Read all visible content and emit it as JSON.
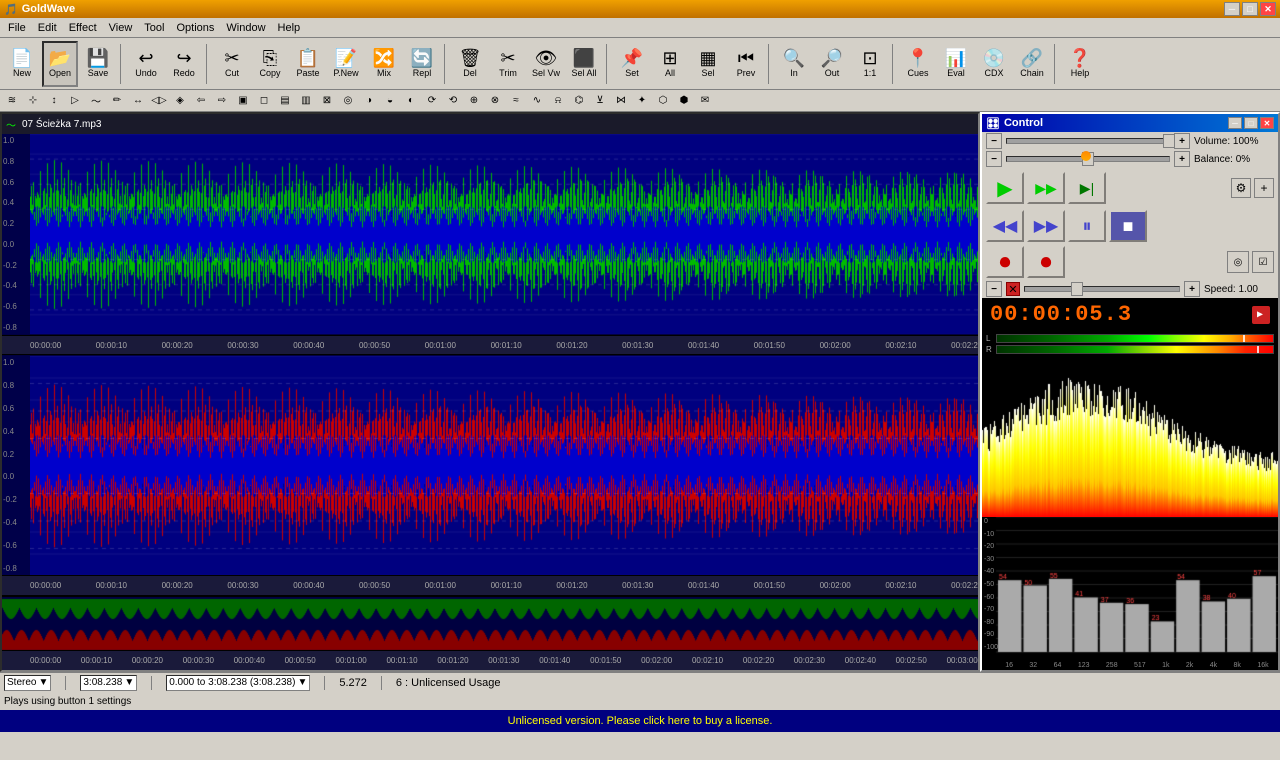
{
  "app": {
    "title": "GoldWave",
    "icon": "🎵"
  },
  "titlebar": {
    "minimize": "─",
    "maximize": "□",
    "close": "✕"
  },
  "menu": {
    "items": [
      "File",
      "Edit",
      "Effect",
      "View",
      "Tool",
      "Options",
      "Window",
      "Help"
    ]
  },
  "toolbar": {
    "buttons": [
      {
        "id": "new",
        "icon": "📄",
        "label": "New"
      },
      {
        "id": "open",
        "icon": "📂",
        "label": "Open"
      },
      {
        "id": "save",
        "icon": "💾",
        "label": "Save"
      },
      {
        "id": "undo",
        "icon": "↩",
        "label": "Undo"
      },
      {
        "id": "redo",
        "icon": "↪",
        "label": "Redo"
      },
      {
        "id": "cut",
        "icon": "✂",
        "label": "Cut"
      },
      {
        "id": "copy",
        "icon": "⎘",
        "label": "Copy"
      },
      {
        "id": "paste",
        "icon": "📋",
        "label": "Paste"
      },
      {
        "id": "pnew",
        "icon": "📝",
        "label": "P.New"
      },
      {
        "id": "mix",
        "icon": "🔀",
        "label": "Mix"
      },
      {
        "id": "repl",
        "icon": "🔄",
        "label": "Repl"
      },
      {
        "id": "del",
        "icon": "🗑",
        "label": "Del"
      },
      {
        "id": "trim",
        "icon": "✂",
        "label": "Trim"
      },
      {
        "id": "selvw",
        "icon": "👁",
        "label": "Sel Vw"
      },
      {
        "id": "selall",
        "icon": "⬛",
        "label": "Sel All"
      },
      {
        "id": "set",
        "icon": "📌",
        "label": "Set"
      },
      {
        "id": "all",
        "icon": "⊞",
        "label": "All"
      },
      {
        "id": "sel",
        "icon": "▦",
        "label": "Sel"
      },
      {
        "id": "prev",
        "icon": "⏮",
        "label": "Prev"
      },
      {
        "id": "zin",
        "icon": "🔍",
        "label": "In"
      },
      {
        "id": "zout",
        "icon": "🔍",
        "label": "Out"
      },
      {
        "id": "z11",
        "icon": "⊡",
        "label": "1:1"
      },
      {
        "id": "cues",
        "icon": "📍",
        "label": "Cues"
      },
      {
        "id": "eval",
        "icon": "📊",
        "label": "Eval"
      },
      {
        "id": "cdx",
        "icon": "💿",
        "label": "CDX"
      },
      {
        "id": "chain",
        "icon": "🔗",
        "label": "Chain"
      },
      {
        "id": "help",
        "icon": "❓",
        "label": "Help"
      }
    ]
  },
  "track": {
    "filename": "07 Ścieżka 7.mp3",
    "duration": "3:08.238",
    "selection": "0.000 to 3:08.238 (3:08.238)",
    "zoom": "5.272",
    "license": "6 : Unlicensed Usage"
  },
  "timeline_marks": [
    "00:00:00",
    "00:00:10",
    "00:00:20",
    "00:00:30",
    "00:00:40",
    "00:00:50",
    "00:01:00",
    "00:01:10",
    "00:01:20",
    "00:01:30",
    "00:01:40",
    "00:01:50",
    "00:02:00",
    "00:02:10",
    "00:02:2"
  ],
  "overview_marks": [
    "00:00:00",
    "00:00:10",
    "00:00:20",
    "00:00:30",
    "00:00:40",
    "00:00:50",
    "00:01:00",
    "00:01:10",
    "00:01:20",
    "00:01:30",
    "00:01:40",
    "00:01:50",
    "00:02:00",
    "00:02:10",
    "00:02:20",
    "00:02:30",
    "00:02:40",
    "00:02:50",
    "00:03:00"
  ],
  "control": {
    "title": "Control",
    "volume_label": "Volume: 100%",
    "balance_label": "Balance: 0%",
    "speed_label": "Speed: 1.00",
    "time": "00:00:05.3",
    "time_icon": "🔴"
  },
  "playback_buttons": [
    {
      "id": "play",
      "icon": "▶",
      "color": "#00cc00"
    },
    {
      "id": "play-loop",
      "icon": "▶▶",
      "color": "#00cc00"
    },
    {
      "id": "play-end",
      "icon": "▶|",
      "color": "#008800"
    },
    {
      "id": "rewind",
      "icon": "◀◀",
      "color": "#4444cc"
    },
    {
      "id": "forward",
      "icon": "▶▶",
      "color": "#4444cc"
    },
    {
      "id": "pause",
      "icon": "⏸",
      "color": "#4444cc"
    },
    {
      "id": "stop",
      "icon": "⏹",
      "color": "#4444cc"
    },
    {
      "id": "record",
      "icon": "⏺",
      "color": "#cc0000"
    },
    {
      "id": "record2",
      "icon": "⏺",
      "color": "#cc0000"
    }
  ],
  "freq_labels": [
    "16",
    "32",
    "64",
    "123",
    "258",
    "517",
    "1k",
    "2k",
    "4k",
    "8k",
    "16k"
  ],
  "db_labels": [
    "0",
    "-10",
    "-20",
    "-30",
    "-40",
    "-50",
    "-60",
    "-70",
    "-80",
    "-90",
    "-100"
  ],
  "status": {
    "channel": "Stereo",
    "duration": "3:08.238",
    "selection": "0.000 to 3:08.238 (3:08.238)",
    "zoom": "5.272",
    "license": "6 : Unlicensed Usage",
    "plays_info": "Plays using button 1 settings",
    "license_notice": "Unlicensed version. Please click here to buy a license."
  },
  "y_axis_top": [
    "1.0",
    "0.8",
    "0.6",
    "0.4",
    "0.2",
    "0.0",
    "-0.2",
    "-0.4",
    "-0.6",
    "-0.8"
  ],
  "y_axis_bottom": [
    "1.0",
    "0.8",
    "0.6",
    "0.4",
    "0.2",
    "0.0",
    "-0.2",
    "-0.4",
    "-0.6",
    "-0.8"
  ]
}
